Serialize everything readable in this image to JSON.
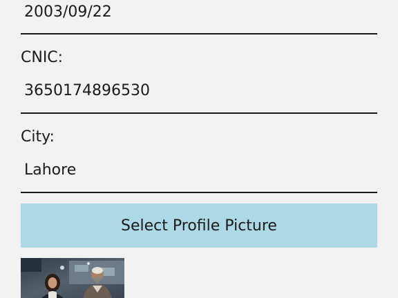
{
  "form": {
    "dob_value": "2003/09/22",
    "cnic_label": "CNIC:",
    "cnic_value": "3650174896530",
    "city_label": "City:",
    "city_value": "Lahore",
    "select_picture_label": "Select Profile Picture"
  },
  "colors": {
    "background": "#f2f2f2",
    "button_background": "#add8e6",
    "text": "#1a1a1a"
  },
  "profile_picture": {
    "icon": "profile-photo-thumbnail"
  }
}
